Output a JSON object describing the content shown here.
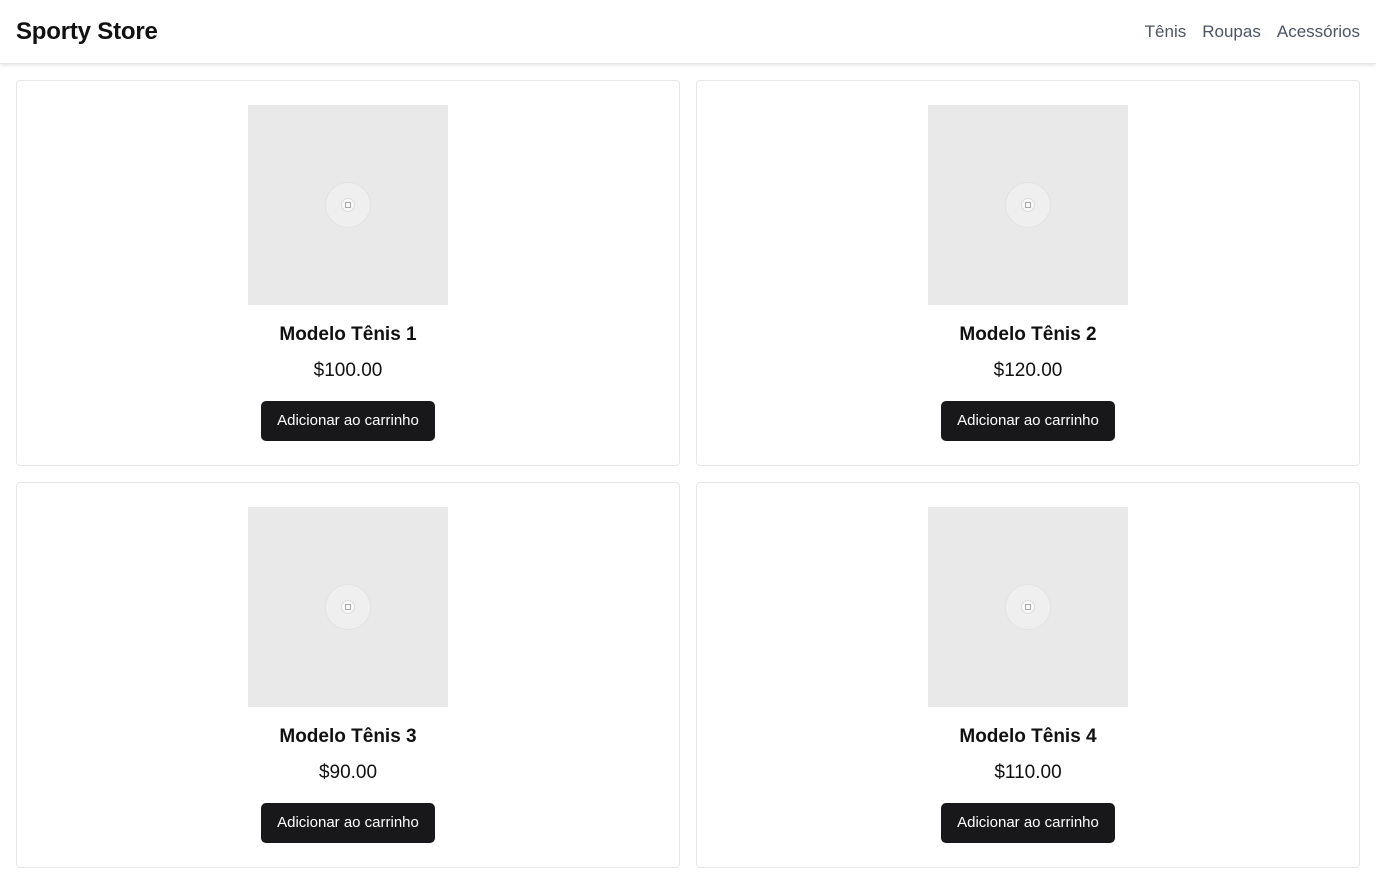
{
  "header": {
    "brand": "Sporty Store",
    "nav": [
      "Tênis",
      "Roupas",
      "Acessórios"
    ]
  },
  "products": [
    {
      "name": "Modelo Tênis 1",
      "price": "$100.00",
      "button_label": "Adicionar ao carrinho"
    },
    {
      "name": "Modelo Tênis 2",
      "price": "$120.00",
      "button_label": "Adicionar ao carrinho"
    },
    {
      "name": "Modelo Tênis 3",
      "price": "$90.00",
      "button_label": "Adicionar ao carrinho"
    },
    {
      "name": "Modelo Tênis 4",
      "price": "$110.00",
      "button_label": "Adicionar ao carrinho"
    }
  ],
  "colors": {
    "button_bg": "#18181b",
    "nav_text": "#4b5563",
    "image_placeholder": "#e9e9e9"
  },
  "icons": {
    "product_image": "image-placeholder-icon"
  }
}
